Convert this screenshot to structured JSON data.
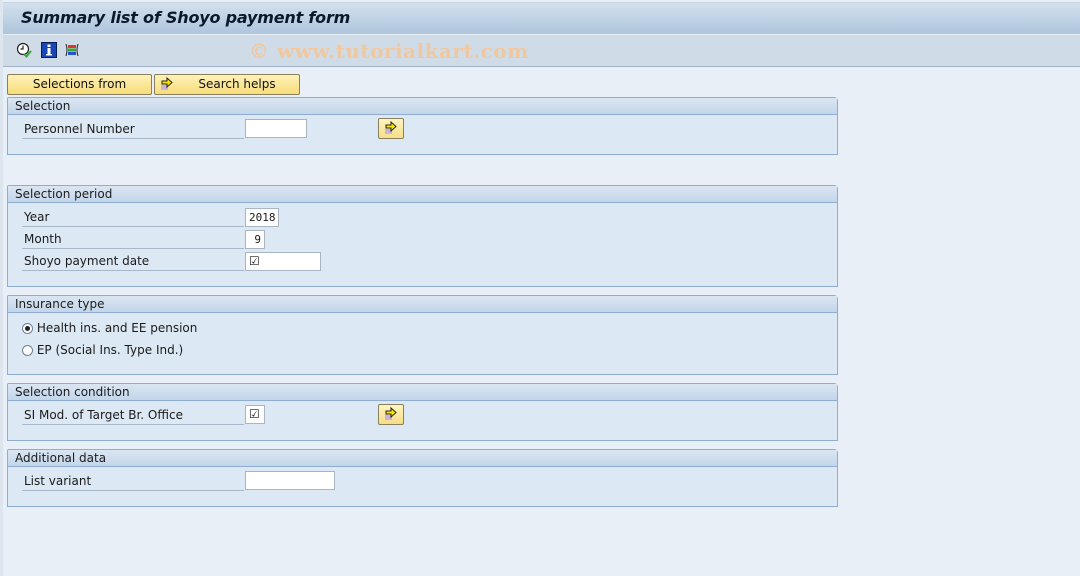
{
  "window": {
    "title": "Summary list of Shoyo payment form"
  },
  "toolbar": {
    "icons": [
      {
        "name": "execute-icon",
        "tooltip": "Execute"
      },
      {
        "name": "info-icon",
        "tooltip": "Program documentation"
      },
      {
        "name": "layout-icon",
        "tooltip": "Layout"
      }
    ],
    "watermark": "© www.tutorialkart.com"
  },
  "buttons": {
    "selections_from": "Selections from",
    "search_helps": "Search helps"
  },
  "groups": {
    "selection": {
      "title": "Selection",
      "personnel_number": {
        "label": "Personnel Number",
        "value": ""
      }
    },
    "selection_period": {
      "title": "Selection period",
      "year": {
        "label": "Year",
        "value": "2018"
      },
      "month": {
        "label": "Month",
        "value": "9"
      },
      "shoyo_payment_date": {
        "label": "Shoyo payment date",
        "value": "☑"
      }
    },
    "insurance_type": {
      "title": "Insurance type",
      "options": [
        {
          "label": "Health ins. and EE pension",
          "selected": true
        },
        {
          "label": "EP (Social Ins. Type Ind.)",
          "selected": false
        }
      ]
    },
    "selection_condition": {
      "title": "Selection condition",
      "si_mod": {
        "label": "SI Mod. of Target Br. Office",
        "value": "☑"
      }
    },
    "additional_data": {
      "title": "Additional data",
      "list_variant": {
        "label": "List variant",
        "value": ""
      }
    }
  }
}
